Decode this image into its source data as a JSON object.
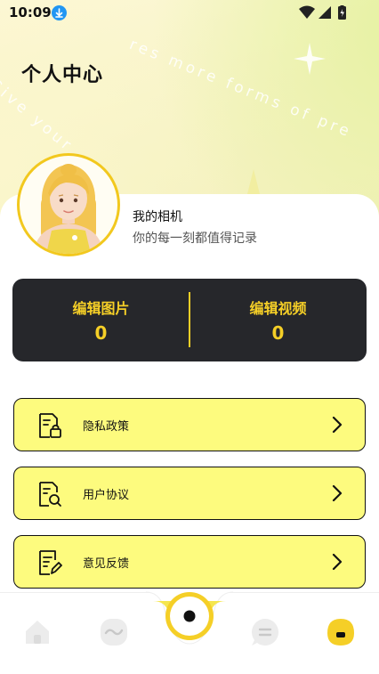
{
  "status_bar": {
    "time": "10:09"
  },
  "background_text": [
    "res more forms of pre",
    "Give your"
  ],
  "header": {
    "title": "个人中心"
  },
  "profile": {
    "name": "我的相机",
    "motto": "你的每一刻都值得记录"
  },
  "stats": [
    {
      "label": "编辑图片",
      "value": "0"
    },
    {
      "label": "编辑视频",
      "value": "0"
    }
  ],
  "menu": [
    {
      "label": "隐私政策",
      "icon": "privacy-lock-icon"
    },
    {
      "label": "用户协议",
      "icon": "document-search-icon"
    },
    {
      "label": "意见反馈",
      "icon": "feedback-edit-icon"
    }
  ],
  "tabs": [
    {
      "icon": "home-icon",
      "active": false
    },
    {
      "icon": "wave-icon",
      "active": false
    },
    {
      "icon": "camera-icon",
      "active": false
    },
    {
      "icon": "chat-icon",
      "active": false
    },
    {
      "icon": "profile-icon",
      "active": true
    }
  ],
  "colors": {
    "accent": "#f5cf27",
    "card_dark": "#26272b",
    "menu_bg": "#fdfb7e"
  }
}
